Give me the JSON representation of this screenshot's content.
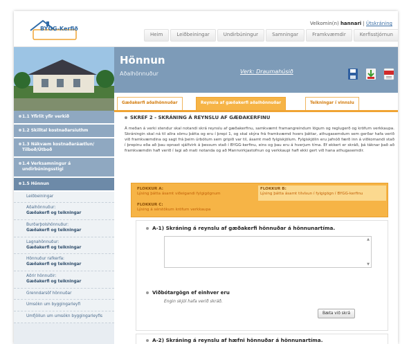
{
  "header": {
    "logo_text": "BYGG-Kerfið",
    "welcome_prefix": "Velkomin(n)",
    "username": "hannari",
    "logout": "Útskráning",
    "nav": [
      "Heim",
      "Leiðbeiningar",
      "Undirbúningur",
      "Samningar",
      "Framkvæmdir",
      "Kerfisstjórnun"
    ]
  },
  "title": {
    "main": "Hönnun",
    "sub": "Aðalhönnuður",
    "project": "Verk: Draumahúsið"
  },
  "tabs": [
    "Gæðakerfi aðalhönnuðar",
    "Reynsla af gæðakerfi aðalhönnuðar",
    "Teikningar í vinnslu"
  ],
  "sidebar": {
    "items": [
      {
        "label": "1.1 Yfirlit yfir verkið"
      },
      {
        "label": "1.2 Skilltal kostnaðarsíuthm"
      },
      {
        "label": "1.3 Nákvæm kostnaðaráætlun/ Tilboð/Útboð"
      },
      {
        "label": "1.4 Verksamningur á undirbúningsstigi"
      },
      {
        "label": "1.5 Hönnun"
      }
    ],
    "subitems": [
      {
        "a": "Leiðbeiningar",
        "b": ""
      },
      {
        "a": "Aðalhönnuður:",
        "b": "Gæðakerfi og teikningar"
      },
      {
        "a": "Burðarþolshönnuður:",
        "b": "Gæðakerfi og teikningar"
      },
      {
        "a": "Lagnahönnuður:",
        "b": "Gæðakerfi og teikningar"
      },
      {
        "a": "Hönnuður rafkerfa:",
        "b": "Gæðakerfi og teikningar"
      },
      {
        "a": "Aðrir hönnuðir:",
        "b": "Gæðakerfi og teikningar"
      },
      {
        "a": "Grenndarsöf hönnuðar",
        "b": ""
      },
      {
        "a": "Umsókn um byggingarleyfi",
        "b": ""
      },
      {
        "a": "Umfjöllun um umsókn byggingarleyfis",
        "b": ""
      }
    ]
  },
  "content": {
    "step_title": "SKREF 2 - SKRÁNING Á REYNSLU AF GÆÐAKERFINU",
    "step_text": "Á meðan á verki stendur skal notandi skrá reynslu af gæðakerfinu, samkvæmt framangreindum lögum og reglugerð og kröfum verkkaupa. Skráningin skal ná til allra sömu þátta og eru í þrepi 1, og skal skýra frá framkvæmd hvers þáttar, athugasemdum sem gerðar hafa verið við framkvæmdina og sagt frá þeim úrbótum sem gripið var til, ásamt með fylgiskjölum. Fylgiskjölin eru jafnóð færð inn á viðkomandi stað í þrepinu eða að þau opnast sjálfvirk á þessum stað í BYGG-kerfinu, eins og þau eru á hverjum tíma. Ef ekkert er skráð, þá táknar það að framkvæmdin hafi verið í lagi að mati notanda og að Mannvirkjastofnun og verkkaupi hafi ekki gert við hana athugasemdir."
  },
  "flokkar": [
    {
      "name": "FLOKKUR A:",
      "desc": "Lýsing þátta ásamt viðeigandi fylgigögnum"
    },
    {
      "name": "FLOKKUR B:",
      "desc": "Lýsing þátta ásamt tilvísun í fylgigögn í BYGG-kerfinu"
    },
    {
      "name": "FLOKKUR C:",
      "desc": "Lýsing á sérstökum kröfum verkkaupa"
    }
  ],
  "panel": {
    "a1_title": "A-1) Skráning á reynslu af gæðakerfi hönnuðar á hönnunartíma.",
    "attachments_title": "Viðbótargögn ef einhver eru",
    "no_files": "Engin skjöl hafa verið skráð.",
    "add_button": "Bæta við skrá",
    "a2_title": "A-2) Skráning á reynslu af hæfni hönnuðar á hönnunartíma."
  },
  "colors": {
    "title_bar": "#7d9bb8",
    "accent_orange": "#f6b446",
    "sidebar_blue": "#8fa8c1",
    "logo_blue": "#2f6aa6"
  }
}
